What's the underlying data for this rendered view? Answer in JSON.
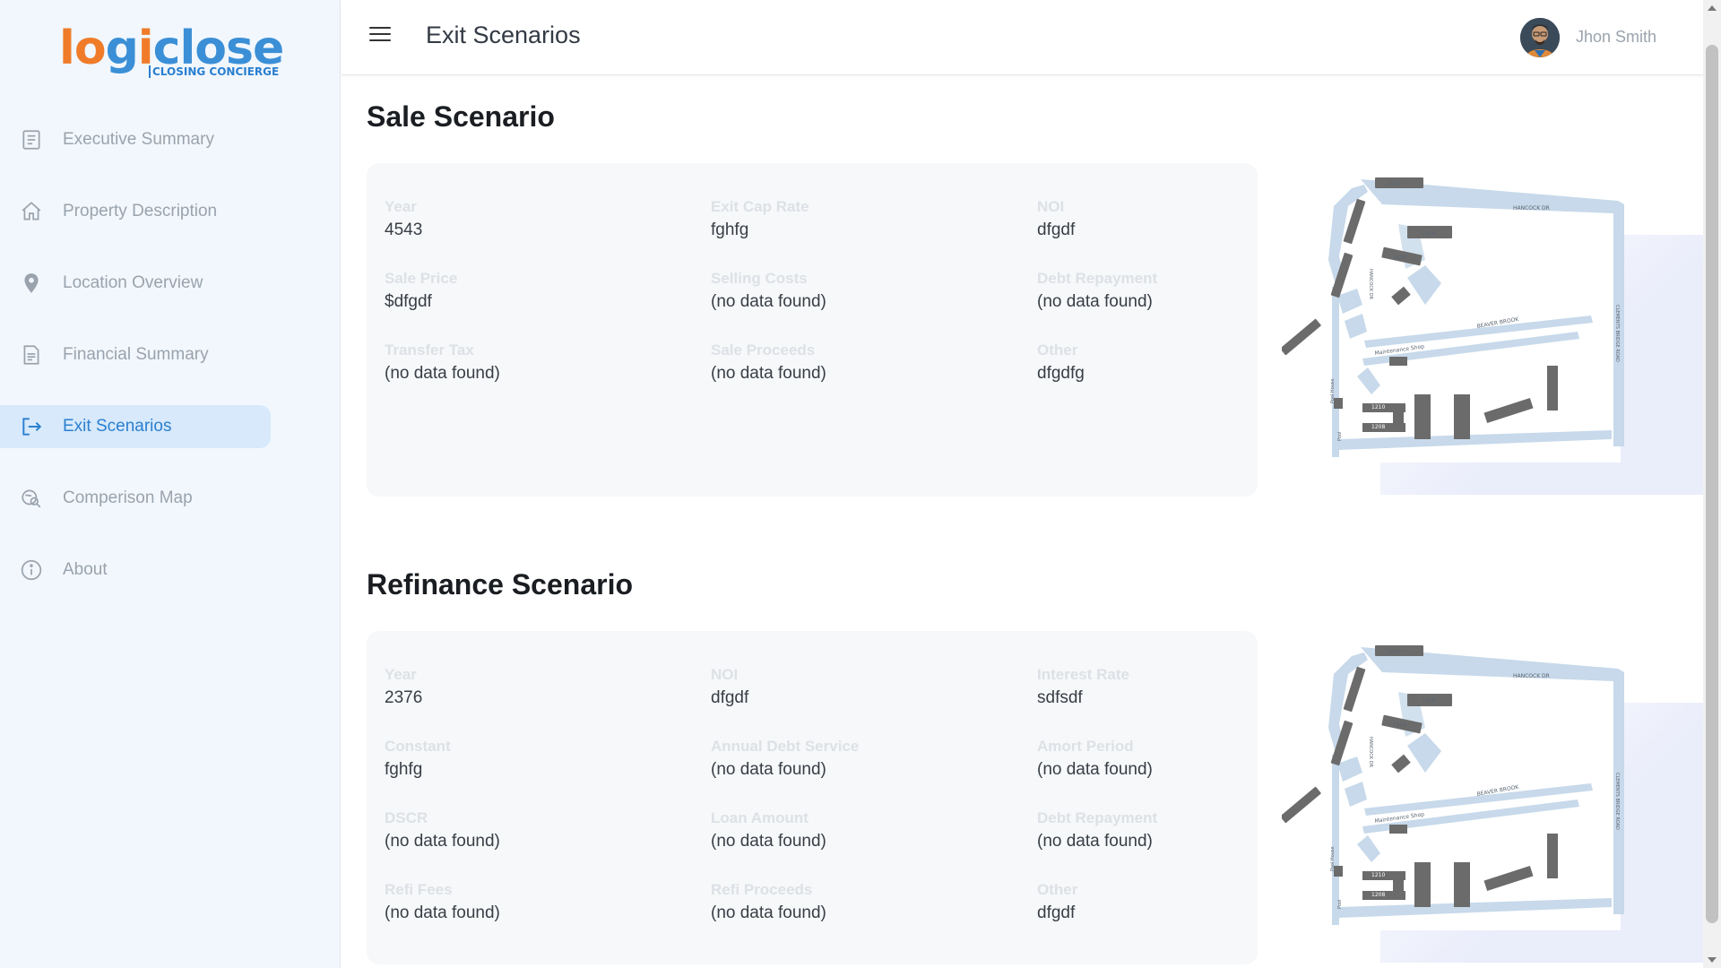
{
  "brand": {
    "logo_text": "logiclose",
    "tagline": "CLOSING CONCIERGE"
  },
  "sidebar": {
    "items": [
      {
        "label": "Executive Summary",
        "icon": "document-icon",
        "active": false
      },
      {
        "label": "Property Description",
        "icon": "home-icon",
        "active": false
      },
      {
        "label": "Location Overview",
        "icon": "location-pin-icon",
        "active": false
      },
      {
        "label": "Financial Summary",
        "icon": "report-icon",
        "active": false
      },
      {
        "label": "Exit Scenarios",
        "icon": "exit-icon",
        "active": true
      },
      {
        "label": "Comperison Map",
        "icon": "map-search-icon",
        "active": false
      },
      {
        "label": "About",
        "icon": "info-icon",
        "active": false
      }
    ]
  },
  "header": {
    "title": "Exit Scenarios",
    "user_name": "Jhon Smith"
  },
  "sale": {
    "title": "Sale Scenario",
    "fields": [
      {
        "label": "Year",
        "value": "4543"
      },
      {
        "label": "Exit Cap Rate",
        "value": "fghfg"
      },
      {
        "label": "NOI",
        "value": "dfgdf"
      },
      {
        "label": "Sale Price",
        "value": "$dfgdf"
      },
      {
        "label": "Selling Costs",
        "value": "(no data found)"
      },
      {
        "label": "Debt Repayment",
        "value": "(no data found)"
      },
      {
        "label": "Transfer Tax",
        "value": "(no data found)"
      },
      {
        "label": "Sale Proceeds",
        "value": "(no data found)"
      },
      {
        "label": "Other",
        "value": "dfgdfg"
      }
    ]
  },
  "refinance": {
    "title": "Refinance Scenario",
    "fields": [
      {
        "label": "Year",
        "value": "2376"
      },
      {
        "label": "NOI",
        "value": "dfgdf"
      },
      {
        "label": "Interest Rate",
        "value": "sdfsdf"
      },
      {
        "label": "Constant",
        "value": "fghfg"
      },
      {
        "label": "Annual Debt Service",
        "value": "(no data found)"
      },
      {
        "label": "Amort Period",
        "value": "(no data found)"
      },
      {
        "label": "DSCR",
        "value": "(no data found)"
      },
      {
        "label": "Loan Amount",
        "value": "(no data found)"
      },
      {
        "label": "Debt Repayment",
        "value": "(no data found)"
      },
      {
        "label": "Refi Fees",
        "value": "(no data found)"
      },
      {
        "label": "Refi Proceeds",
        "value": "(no data found)"
      },
      {
        "label": "Other",
        "value": "dfgdf"
      }
    ]
  },
  "site_map": {
    "street_labels": [
      "HANCOCK DR",
      "HANCOCK DR",
      "CLEMENTS BRIDGE ROAD",
      "BEAVER BROOK",
      "Maintenance Shop",
      "Pool House",
      "Pool"
    ],
    "building_labels": [
      "1507",
      "1306",
      "1404",
      "1303",
      "1302",
      "1301",
      "1210",
      "1208",
      "1205",
      "1204",
      "1202",
      "1201"
    ]
  },
  "colors": {
    "accent": "#2a7fd0",
    "sidebar_bg": "#f1f7fd",
    "active_bg": "#d7e9fb",
    "logo_orange": "#f07c2a",
    "logo_blue": "#3b8fd6"
  }
}
